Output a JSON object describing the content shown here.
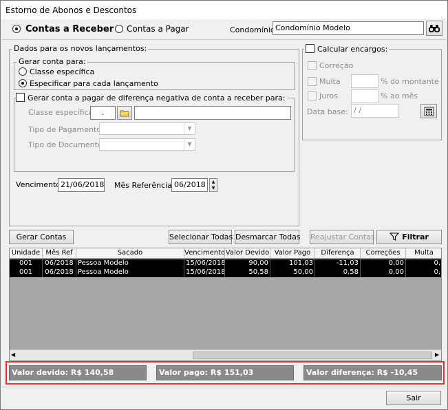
{
  "window": {
    "title": "Estorno de Abonos e Descontos"
  },
  "top": {
    "radio_receber": "Contas a Receber",
    "radio_pagar": "Contas a Pagar",
    "condominio_label": "Condomínio:",
    "condominio_value": "Condomínio Modelo"
  },
  "dados": {
    "title": "Dados para os novos lançamentos:",
    "gerar_conta_title": "Gerar conta para:",
    "opt_classe": "Classe específica",
    "opt_especificar": "Especificar para cada lançamento",
    "gerar_pagar_label": "Gerar conta a pagar de diferença negativa de conta a receber para:",
    "classe_label": "Classe específica",
    "classe_value": ".",
    "tipo_pagamento_label": "Tipo de Pagamento:",
    "tipo_documento_label": "Tipo de Documento:",
    "vencimento_label": "Vencimento:",
    "vencimento_value": "21/06/2018",
    "mes_ref_label": "Mês Referência:",
    "mes_ref_value": "06/2018"
  },
  "encargos": {
    "title": "Calcular encargos:",
    "correcao": "Correção",
    "multa": "Multa",
    "multa_suffix": "% do montante",
    "juros": "Juros",
    "juros_suffix": "% ao mês",
    "data_base_label": "Data base:",
    "data_base_value": " / /"
  },
  "buttons": {
    "gerar_contas": "Gerar Contas",
    "selecionar_todas": "Selecionar Todas",
    "desmarcar_todas": "Desmarcar Todas",
    "reajustar_contas": "Reajustar Contas",
    "filtrar": "Filtrar",
    "sair": "Sair"
  },
  "table": {
    "columns": [
      "Unidade",
      "Mês Ref",
      "Sacado",
      "Vencimento",
      "Valor Devido",
      "Valor Pago",
      "Diferença",
      "Correções",
      "Multa"
    ],
    "rows": [
      [
        "001",
        "06/2018",
        "Pessoa Modelo",
        "15/06/2018",
        "90,00",
        "101,03",
        "-11,03",
        "0,00",
        "0,"
      ],
      [
        "001",
        "06/2018",
        "Pessoa Modelo",
        "15/06/2018",
        "50,58",
        "50,00",
        "0,58",
        "0,00",
        "0,"
      ]
    ]
  },
  "totals": {
    "valor_devido": "Valor devido: R$ 140,58",
    "valor_pago": "Valor pago: R$ 151,03",
    "valor_diferenca": "Valor diferença: R$ -10,45"
  },
  "colors": {
    "highlight_border": "#e03030",
    "row_bg": "#000000",
    "grid_bg": "#a7a7a7"
  }
}
